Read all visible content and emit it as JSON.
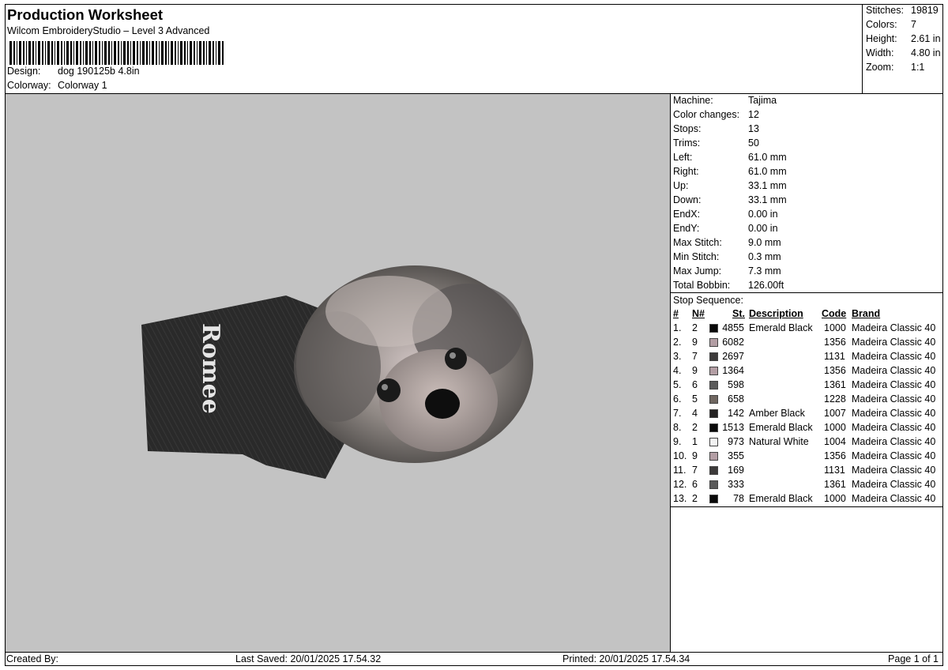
{
  "header": {
    "title": "Production Worksheet",
    "subtitle": "Wilcom EmbroideryStudio – Level 3 Advanced",
    "design_label": "Design:",
    "design_value": "dog 190125b 4.8in",
    "colorway_label": "Colorway:",
    "colorway_value": "Colorway 1"
  },
  "stats": [
    {
      "label": "Stitches:",
      "value": "19819"
    },
    {
      "label": "Colors:",
      "value": "7"
    },
    {
      "label": "Height:",
      "value": "2.61 in"
    },
    {
      "label": "Width:",
      "value": "4.80 in"
    },
    {
      "label": "Zoom:",
      "value": "1:1"
    }
  ],
  "design": {
    "shirt_text": "Romee",
    "background_color": "#c3c3c3"
  },
  "specs": [
    {
      "label": "Machine:",
      "value": "Tajima"
    },
    {
      "label": "Color changes:",
      "value": "12"
    },
    {
      "label": "Stops:",
      "value": "13"
    },
    {
      "label": "Trims:",
      "value": "50"
    },
    {
      "label": "Left:",
      "value": "61.0 mm"
    },
    {
      "label": "Right:",
      "value": "61.0 mm"
    },
    {
      "label": "Up:",
      "value": "33.1 mm"
    },
    {
      "label": "Down:",
      "value": "33.1 mm"
    },
    {
      "label": "EndX:",
      "value": "0.00 in"
    },
    {
      "label": "EndY:",
      "value": "0.00 in"
    },
    {
      "label": "Max Stitch:",
      "value": "9.0 mm"
    },
    {
      "label": "Min Stitch:",
      "value": "0.3 mm"
    },
    {
      "label": "Max Jump:",
      "value": "7.3 mm"
    },
    {
      "label": "Total Bobbin:",
      "value": "126.00ft"
    }
  ],
  "stop_sequence": {
    "title": "Stop Sequence:",
    "headers": {
      "num": "#",
      "n": "N#",
      "st": "St.",
      "description": "Description",
      "code": "Code",
      "brand": "Brand"
    },
    "rows": [
      {
        "num": "1.",
        "n": "2",
        "color": "#0a0a0a",
        "st": "4855",
        "description": "Emerald Black",
        "code": "1000",
        "brand": "Madeira Classic 40"
      },
      {
        "num": "2.",
        "n": "9",
        "color": "#b39ea4",
        "st": "6082",
        "description": "",
        "code": "1356",
        "brand": "Madeira Classic 40"
      },
      {
        "num": "3.",
        "n": "7",
        "color": "#3c3a3a",
        "st": "2697",
        "description": "",
        "code": "1131",
        "brand": "Madeira Classic 40"
      },
      {
        "num": "4.",
        "n": "9",
        "color": "#b39ea4",
        "st": "1364",
        "description": "",
        "code": "1356",
        "brand": "Madeira Classic 40"
      },
      {
        "num": "5.",
        "n": "6",
        "color": "#5a5a5a",
        "st": "598",
        "description": "",
        "code": "1361",
        "brand": "Madeira Classic 40"
      },
      {
        "num": "6.",
        "n": "5",
        "color": "#6f6660",
        "st": "658",
        "description": "",
        "code": "1228",
        "brand": "Madeira Classic 40"
      },
      {
        "num": "7.",
        "n": "4",
        "color": "#242222",
        "st": "142",
        "description": "Amber Black",
        "code": "1007",
        "brand": "Madeira Classic 40"
      },
      {
        "num": "8.",
        "n": "2",
        "color": "#0a0a0a",
        "st": "1513",
        "description": "Emerald Black",
        "code": "1000",
        "brand": "Madeira Classic 40"
      },
      {
        "num": "9.",
        "n": "1",
        "color": "#f2f2f2",
        "st": "973",
        "description": "Natural White",
        "code": "1004",
        "brand": "Madeira Classic 40"
      },
      {
        "num": "10.",
        "n": "9",
        "color": "#b39ea4",
        "st": "355",
        "description": "",
        "code": "1356",
        "brand": "Madeira Classic 40"
      },
      {
        "num": "11.",
        "n": "7",
        "color": "#3c3a3a",
        "st": "169",
        "description": "",
        "code": "1131",
        "brand": "Madeira Classic 40"
      },
      {
        "num": "12.",
        "n": "6",
        "color": "#5a5a5a",
        "st": "333",
        "description": "",
        "code": "1361",
        "brand": "Madeira Classic 40"
      },
      {
        "num": "13.",
        "n": "2",
        "color": "#0a0a0a",
        "st": "78",
        "description": "Emerald Black",
        "code": "1000",
        "brand": "Madeira Classic 40"
      }
    ]
  },
  "footer": {
    "created_by": "Created By:",
    "last_saved": "Last Saved: 20/01/2025 17.54.32",
    "printed": "Printed: 20/01/2025 17.54.34",
    "page": "Page 1 of 1"
  }
}
